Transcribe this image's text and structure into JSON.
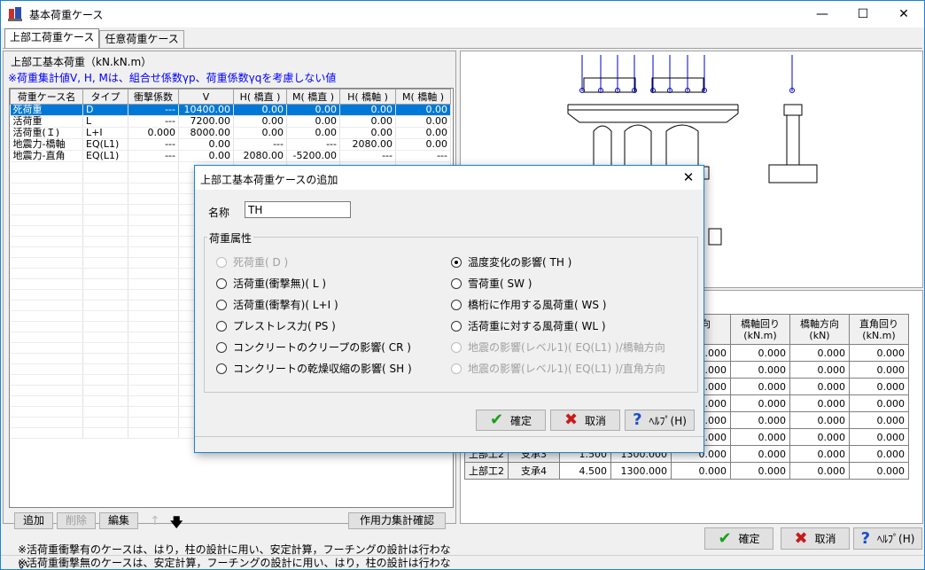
{
  "window": {
    "title": "基本荷重ケース",
    "min": "—",
    "max": "☐",
    "close": "✕"
  },
  "tabs": [
    "上部工荷重ケース",
    "任意荷重ケース"
  ],
  "left": {
    "title": "上部工基本荷重（kN.kN.m）",
    "note": "※荷重集計値V, H, Mは、組合せ係数γp、荷重係数γqを考慮しない値",
    "columns": [
      "荷重ケース名",
      "タイプ",
      "衝撃係数",
      "V",
      "H( 橋直 )",
      "M( 橋直 )",
      "H( 橋軸 )",
      "M( 橋軸 )"
    ],
    "rows": [
      [
        "死荷重",
        "D",
        "---",
        "10400.00",
        "0.00",
        "0.00",
        "0.00",
        "0.00"
      ],
      [
        "活荷重",
        "L",
        "---",
        "7200.00",
        "0.00",
        "0.00",
        "0.00",
        "0.00"
      ],
      [
        "活荷重(Ｉ)",
        "L+I",
        "0.000",
        "8000.00",
        "0.00",
        "0.00",
        "0.00",
        "0.00"
      ],
      [
        "地震力-橋軸",
        "EQ(L1)",
        "---",
        "0.00",
        "---",
        "---",
        "2080.00",
        "0.00"
      ],
      [
        "地震力-直角",
        "EQ(L1)",
        "---",
        "0.00",
        "2080.00",
        "-5200.00",
        "---",
        "---"
      ]
    ],
    "buttons": {
      "add": "追加",
      "del": "削除",
      "edit": "編集",
      "up": "↑",
      "down": "🡇",
      "sum": "作用力集計確認"
    },
    "foot1": "※活荷重衝撃有のケースは、はり，柱の設計に用い、安定計算，フーチングの設計は行わない",
    "foot2": "※活荷重衝撃無のケースは、安定計算，フーチングの設計に用い、はり，柱の設計は行わない"
  },
  "right": {
    "columns": [
      "",
      "",
      "",
      "",
      "方向\n)",
      "橋軸回り\n(kN.m)",
      "橋軸方向\n(kN)",
      "直角回り\n(kN.m)"
    ],
    "rows": [
      [
        "",
        "",
        "",
        "",
        "0.000",
        "0.000",
        "0.000",
        "0.000"
      ],
      [
        "",
        "",
        "",
        "",
        "0.000",
        "0.000",
        "0.000",
        "0.000"
      ],
      [
        "",
        "",
        "",
        "",
        "0.000",
        "0.000",
        "0.000",
        "0.000"
      ],
      [
        "",
        "",
        "",
        "",
        "0.000",
        "0.000",
        "0.000",
        "0.000"
      ],
      [
        "",
        "",
        "",
        "",
        "0.000",
        "0.000",
        "0.000",
        "0.000"
      ],
      [
        "",
        "",
        "",
        "",
        "0.000",
        "0.000",
        "0.000",
        "0.000"
      ],
      [
        "上部工2",
        "支承3",
        "1.500",
        "1300.000",
        "0.000",
        "0.000",
        "0.000",
        "0.000"
      ],
      [
        "上部工2",
        "支承4",
        "4.500",
        "1300.000",
        "0.000",
        "0.000",
        "0.000",
        "0.000"
      ]
    ]
  },
  "main_buttons": {
    "ok": "確定",
    "cancel": "取消",
    "help": "ﾍﾙﾌﾟ(H)"
  },
  "dialog": {
    "title": "上部工基本荷重ケースの追加",
    "close": "✕",
    "name_label": "名称",
    "name_value": "TH",
    "group_label": "荷重属性",
    "left_options": [
      {
        "label": "死荷重( D )",
        "enabled": false,
        "checked": false
      },
      {
        "label": "活荷重(衝撃無)( L )",
        "enabled": true,
        "checked": false
      },
      {
        "label": "活荷重(衝撃有)( L+I )",
        "enabled": true,
        "checked": false
      },
      {
        "label": "プレストレス力( PS )",
        "enabled": true,
        "checked": false
      },
      {
        "label": "コンクリートのクリープの影響( CR )",
        "enabled": true,
        "checked": false
      },
      {
        "label": "コンクリートの乾燥収縮の影響( SH )",
        "enabled": true,
        "checked": false
      }
    ],
    "right_options": [
      {
        "label": "温度変化の影響( TH )",
        "enabled": true,
        "checked": true
      },
      {
        "label": "雪荷重( SW )",
        "enabled": true,
        "checked": false
      },
      {
        "label": "橋桁に作用する風荷重( WS )",
        "enabled": true,
        "checked": false
      },
      {
        "label": "活荷重に対する風荷重( WL )",
        "enabled": true,
        "checked": false
      },
      {
        "label": "地震の影響(レベル1)( EQ(L1) )/橋軸方向",
        "enabled": false,
        "checked": false
      },
      {
        "label": "地震の影響(レベル1)( EQ(L1) )/直角方向",
        "enabled": false,
        "checked": false
      }
    ],
    "ok": "確定",
    "cancel": "取消",
    "help": "ﾍﾙﾌﾟ(H)"
  }
}
